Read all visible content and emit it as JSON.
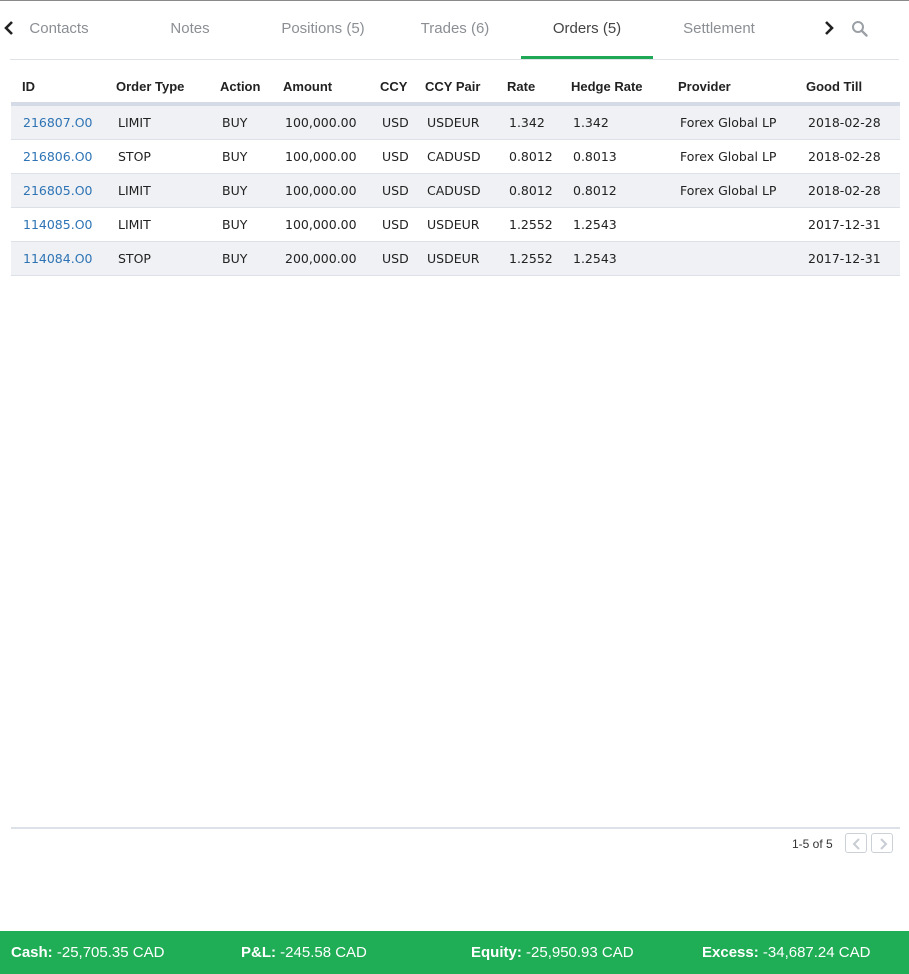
{
  "tabs": [
    {
      "label": "Contacts"
    },
    {
      "label": "Notes"
    },
    {
      "label": "Positions (5)"
    },
    {
      "label": "Trades (6)"
    },
    {
      "label": "Orders (5)"
    },
    {
      "label": "Settlement"
    }
  ],
  "active_tab": "Orders (5)",
  "table": {
    "headers": [
      "ID",
      "Order Type",
      "Action",
      "Amount",
      "CCY",
      "CCY Pair",
      "Rate",
      "Hedge Rate",
      "Provider",
      "Good Till"
    ],
    "rows": [
      {
        "id": "216807.O0",
        "order_type": "LIMIT",
        "action": "BUY",
        "amount": "100,000.00",
        "ccy": "USD",
        "pair": "USDEUR",
        "rate": "1.342",
        "hedge": "1.342",
        "provider": "Forex Global LP",
        "good_till": "2018-02-28"
      },
      {
        "id": "216806.O0",
        "order_type": "STOP",
        "action": "BUY",
        "amount": "100,000.00",
        "ccy": "USD",
        "pair": "CADUSD",
        "rate": "0.8012",
        "hedge": "0.8013",
        "provider": "Forex Global LP",
        "good_till": "2018-02-28"
      },
      {
        "id": "216805.O0",
        "order_type": "LIMIT",
        "action": "BUY",
        "amount": "100,000.00",
        "ccy": "USD",
        "pair": "CADUSD",
        "rate": "0.8012",
        "hedge": "0.8012",
        "provider": "Forex Global LP",
        "good_till": "2018-02-28"
      },
      {
        "id": "114085.O0",
        "order_type": "LIMIT",
        "action": "BUY",
        "amount": "100,000.00",
        "ccy": "USD",
        "pair": "USDEUR",
        "rate": "1.2552",
        "hedge": "1.2543",
        "provider": "",
        "good_till": "2017-12-31"
      },
      {
        "id": "114084.O0",
        "order_type": "STOP",
        "action": "BUY",
        "amount": "200,000.00",
        "ccy": "USD",
        "pair": "USDEUR",
        "rate": "1.2552",
        "hedge": "1.2543",
        "provider": "",
        "good_till": "2017-12-31"
      }
    ]
  },
  "pager": {
    "text": "1-5 of 5"
  },
  "status": {
    "cash_label": "Cash:",
    "cash_value": " -25,705.35 CAD",
    "pl_label": "P&L:",
    "pl_value": " -245.58 CAD",
    "equity_label": "Equity:",
    "equity_value": " -25,950.93 CAD",
    "excess_label": "Excess:",
    "excess_value": " -34,687.24 CAD"
  },
  "colors": {
    "accent": "#1fa855",
    "status_bar": "#1fad55",
    "link": "#2e74b5",
    "row_alt": "#eff1f4"
  },
  "icons": [
    "chevron-left-icon",
    "chevron-right-icon",
    "search-icon"
  ]
}
